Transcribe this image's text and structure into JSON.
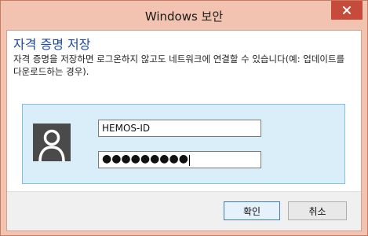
{
  "window": {
    "title": "Windows 보안",
    "close_icon": "close-x-icon"
  },
  "dialog": {
    "heading": "자격 증명 저장",
    "description": "자격 증명을 저장하면 로그온하지 않고도 네트워크에 연결할 수 있습니다(예: 업데이트를 다운로드하는 경우)."
  },
  "credentials": {
    "avatar_icon": "user-avatar-icon",
    "username": "HEMOS-ID",
    "password_mask": "●●●●●●●●●"
  },
  "buttons": {
    "ok_label": "확인",
    "cancel_label": "취소"
  },
  "colors": {
    "title_bar": "#f2c3b0",
    "close_button": "#c74b3a",
    "heading_text": "#1f4aa0",
    "credential_panel": "#d9eef9",
    "credential_border": "#7fc0e4"
  }
}
